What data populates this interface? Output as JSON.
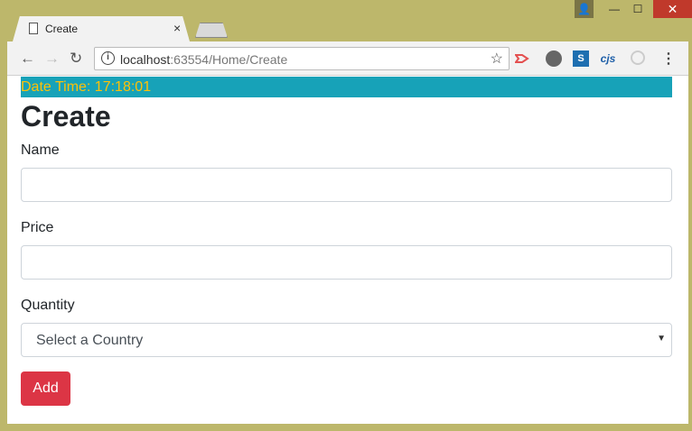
{
  "window": {
    "user_icon": "👤",
    "minimize": "—",
    "maximize": "☐",
    "close": "✕"
  },
  "tab": {
    "title": "Create",
    "close": "×"
  },
  "toolbar": {
    "back": "←",
    "forward": "→",
    "reload": "↻",
    "url_host": "localhost",
    "url_path": ":63554/Home/Create",
    "info": "i",
    "star": "☆",
    "ext_4_label": "cjs",
    "ext_3_label": "S",
    "menu": "⋮"
  },
  "page": {
    "banner": "Date Time: 17:18:01",
    "title": "Create",
    "name_label": "Name",
    "price_label": "Price",
    "quantity_label": "Quantity",
    "select_value": "Select a Country",
    "add_button": "Add"
  },
  "colors": {
    "banner_bg": "#17a2b8",
    "banner_text": "#ffc107",
    "add_button": "#dc3545",
    "window_frame": "#bdb76b"
  }
}
